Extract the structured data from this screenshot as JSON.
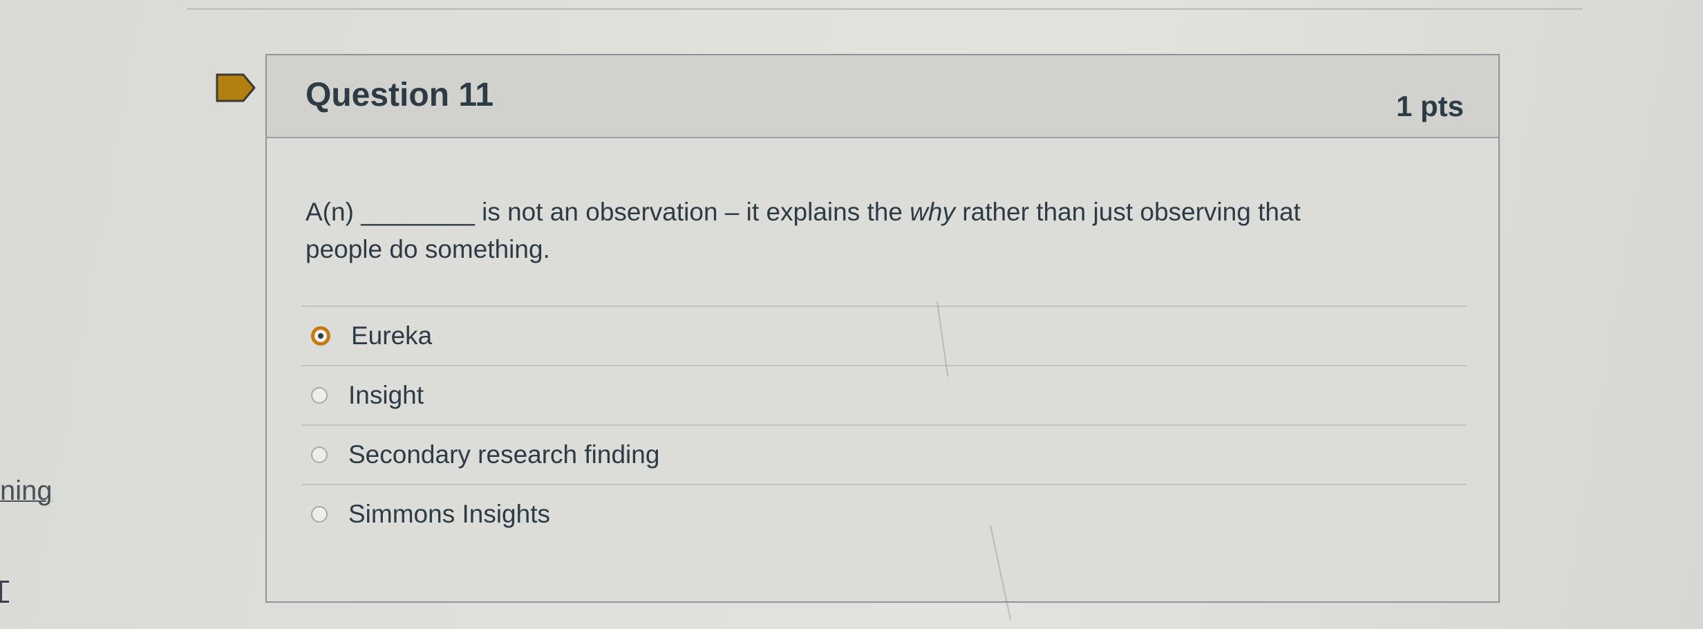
{
  "sidebar": {
    "partial_text": "ning"
  },
  "question": {
    "title": "Question 11",
    "points": "1 pts",
    "text_before_blank": "A(n) ",
    "blank": "________",
    "text_middle": " is not an observation – it explains the ",
    "emphasis": "why",
    "text_after": " rather than just observing that people do something.",
    "answers": [
      {
        "label": "Eureka",
        "selected": true
      },
      {
        "label": "Insight",
        "selected": false
      },
      {
        "label": "Secondary research finding",
        "selected": false
      },
      {
        "label": "Simmons Insights",
        "selected": false
      }
    ]
  },
  "colors": {
    "selected_radio": "#c47a10",
    "flag": "#b37f10",
    "text": "#2d3b45"
  },
  "icons": {
    "flag": "flag-icon"
  }
}
